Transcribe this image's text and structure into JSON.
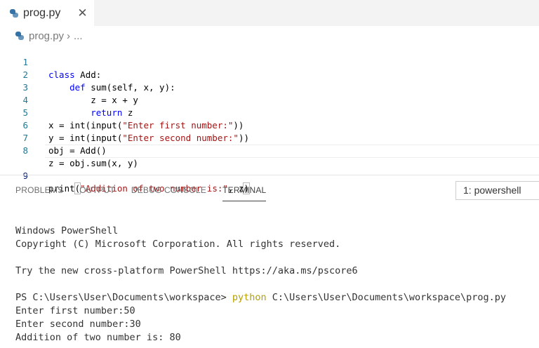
{
  "tab": {
    "label": "prog.py",
    "close": "✕"
  },
  "breadcrumb": {
    "file": "prog.py",
    "separator": "›",
    "more": "..."
  },
  "editor": {
    "lines": [
      {
        "num": "1"
      },
      {
        "num": "2"
      },
      {
        "num": "3"
      },
      {
        "num": "4"
      },
      {
        "num": "5"
      },
      {
        "num": "6"
      },
      {
        "num": "7"
      },
      {
        "num": "8"
      },
      {
        "num": "9"
      }
    ],
    "tokens": {
      "l1_kw": "class",
      "l1_rest": " Add:",
      "l2_indent": "    ",
      "l2_kw": "def",
      "l2_rest": " sum(self, x, y):",
      "l3": "        z = x + y",
      "l4_indent": "        ",
      "l4_kw": "return",
      "l4_rest": " z",
      "l5_a": "x = int(input(",
      "l5_str": "\"Enter first number:\"",
      "l5_b": "))",
      "l6_a": "y = int(input(",
      "l6_str": "\"Enter second number:\"",
      "l6_b": "))",
      "l7": "obj = Add()",
      "l8": "z = obj.sum(x, y)",
      "l9_a": "print",
      "l9_open": "(",
      "l9_str": "\"Addition of two number is:\"",
      "l9_b": ", z",
      "l9_close": ")"
    }
  },
  "panel": {
    "tabs": [
      "PROBLEMS",
      "OUTPUT",
      "DEBUG CONSOLE",
      "TERMINAL"
    ],
    "active_tab": "TERMINAL",
    "shell_select": "1: powershell"
  },
  "terminal": {
    "line1": "Windows PowerShell",
    "line2": "Copyright (C) Microsoft Corporation. All rights reserved.",
    "line3": "",
    "line4": "Try the new cross-platform PowerShell https://aka.ms/pscore6",
    "line5": "",
    "prompt": "PS C:\\Users\\User\\Documents\\workspace> ",
    "cmd": "python",
    "cmd_args": " C:\\Users\\User\\Documents\\workspace\\prog.py",
    "line7": "Enter first number:50",
    "line8": "Enter second number:30",
    "line9": "Addition of two number is: 80"
  },
  "colors": {
    "keyword": "#0000ff",
    "string": "#a31515",
    "line_number": "#237893",
    "terminal_command": "#b5a000"
  }
}
